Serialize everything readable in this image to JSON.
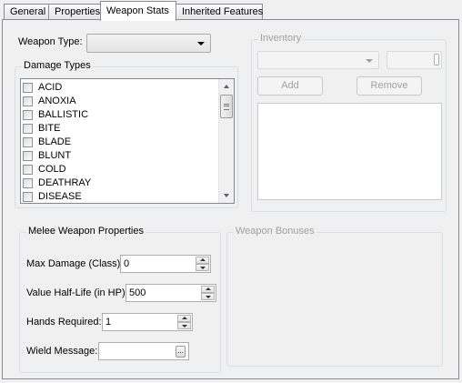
{
  "tabs": [
    {
      "label": "General"
    },
    {
      "label": "Properties"
    },
    {
      "label": "Weapon Stats"
    },
    {
      "label": "Inherited Features"
    }
  ],
  "weapon_type": {
    "label": "Weapon Type:",
    "value": ""
  },
  "damage_types": {
    "title": "Damage Types",
    "items": [
      "ACID",
      "ANOXIA",
      "BALLISTIC",
      "BITE",
      "BLADE",
      "BLUNT",
      "COLD",
      "DEATHRAY",
      "DISEASE"
    ]
  },
  "inventory": {
    "title": "Inventory",
    "combo_value": "",
    "qty_value": "",
    "add_label": "Add",
    "remove_label": "Remove"
  },
  "melee": {
    "title": "Melee Weapon Properties",
    "max_damage": {
      "label": "Max Damage (Class):",
      "value": "0"
    },
    "half_life": {
      "label": "Value Half-Life (in HP):",
      "value": "500"
    },
    "hands": {
      "label": "Hands Required:",
      "value": "1"
    },
    "wield": {
      "label": "Wield Message:",
      "value": "",
      "button": "..."
    }
  },
  "bonuses": {
    "title": "Weapon Bonuses"
  }
}
